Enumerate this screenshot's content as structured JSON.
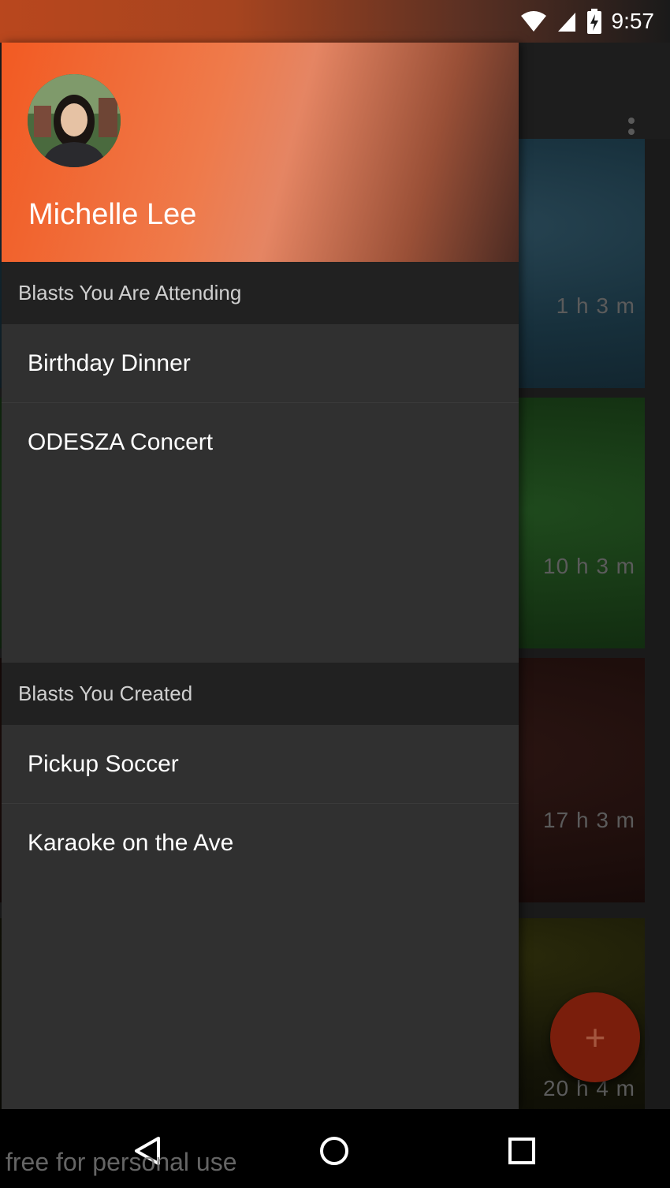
{
  "status_bar": {
    "time": "9:57"
  },
  "drawer": {
    "user_name": "Michelle Lee",
    "sections": [
      {
        "title": "Blasts You Are Attending",
        "items": [
          "Birthday Dinner",
          "ODESZA Concert"
        ]
      },
      {
        "title": "Blasts You Created",
        "items": [
          "Pickup Soccer",
          "Karaoke on the Ave"
        ]
      }
    ]
  },
  "background_feed": {
    "cards": [
      {
        "time": "1 h 3 m"
      },
      {
        "time": "10 h 3 m"
      },
      {
        "time": "17 h 3 m"
      },
      {
        "time": "20 h 4 m"
      }
    ],
    "fab_label": "+"
  },
  "watermark": "free for personal use",
  "colors": {
    "accent": "#f25a22",
    "drawer_bg": "#303030",
    "section_bg": "#212121",
    "fab": "#7a1e0c"
  }
}
